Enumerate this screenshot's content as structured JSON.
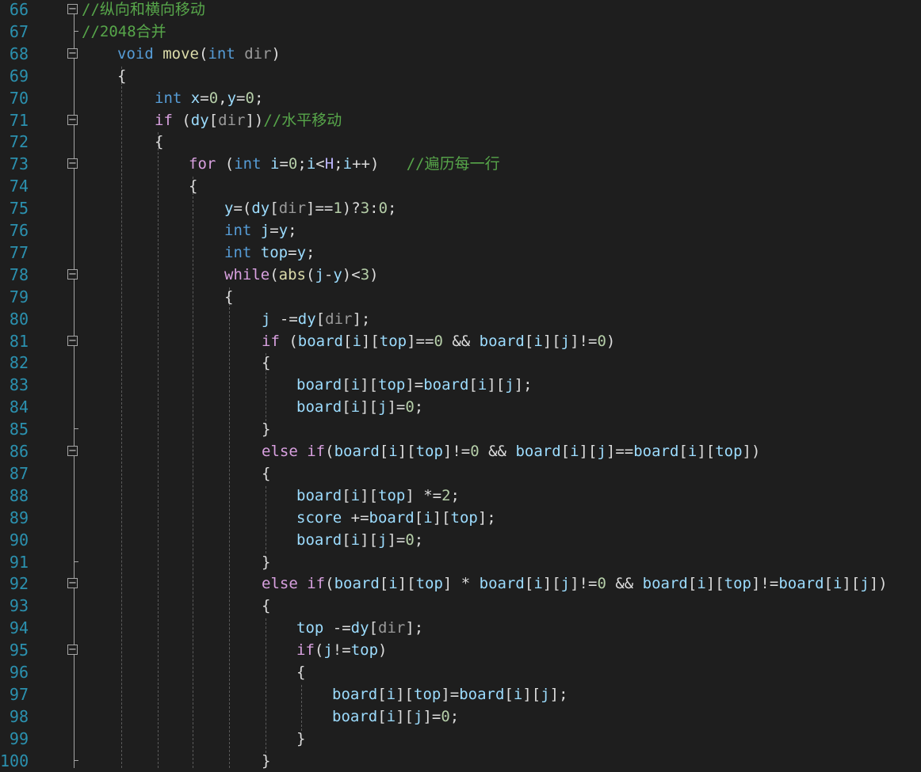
{
  "editor": {
    "theme_colors": {
      "background": "#1e1e1e",
      "line_number": "#2b91af",
      "keyword": "#569cd6",
      "control": "#d8a0df",
      "function": "#dcdcaa",
      "variable": "#9cdcfe",
      "parameter": "#9a9a9a",
      "number": "#b5cea8",
      "comment": "#57a64a",
      "plain": "#dcdcdc"
    },
    "fold_collapse_glyph": "−",
    "lines": [
      {
        "n": "66",
        "fold": "box",
        "indent": 0,
        "tokens": [
          [
            "cmt",
            "//纵向和横向移动"
          ]
        ]
      },
      {
        "n": "67",
        "fold": "end",
        "indent": 0,
        "tokens": [
          [
            "cmt",
            "//2048合并"
          ]
        ]
      },
      {
        "n": "68",
        "fold": "box",
        "indent": 1,
        "tokens": [
          [
            "kw",
            "void"
          ],
          [
            "op",
            " "
          ],
          [
            "fn",
            "move"
          ],
          [
            "op",
            "("
          ],
          [
            "kw",
            "int"
          ],
          [
            "op",
            " "
          ],
          [
            "param",
            "dir"
          ],
          [
            "op",
            ")"
          ]
        ]
      },
      {
        "n": "69",
        "fold": "",
        "indent": 1,
        "tokens": [
          [
            "op",
            "{"
          ]
        ]
      },
      {
        "n": "70",
        "fold": "",
        "indent": 2,
        "tokens": [
          [
            "kw",
            "int"
          ],
          [
            "op",
            " "
          ],
          [
            "var",
            "x"
          ],
          [
            "op",
            "="
          ],
          [
            "num",
            "0"
          ],
          [
            "op",
            ","
          ],
          [
            "var",
            "y"
          ],
          [
            "op",
            "="
          ],
          [
            "num",
            "0"
          ],
          [
            "op",
            ";"
          ]
        ]
      },
      {
        "n": "71",
        "fold": "box",
        "indent": 2,
        "tokens": [
          [
            "ctl",
            "if"
          ],
          [
            "op",
            " ("
          ],
          [
            "var",
            "dy"
          ],
          [
            "op",
            "["
          ],
          [
            "param",
            "dir"
          ],
          [
            "op",
            "])"
          ],
          [
            "cmt",
            "//水平移动"
          ]
        ]
      },
      {
        "n": "72",
        "fold": "",
        "indent": 2,
        "tokens": [
          [
            "op",
            "{"
          ]
        ]
      },
      {
        "n": "73",
        "fold": "box",
        "indent": 3,
        "tokens": [
          [
            "ctl",
            "for"
          ],
          [
            "op",
            " ("
          ],
          [
            "kw",
            "int"
          ],
          [
            "op",
            " "
          ],
          [
            "var",
            "i"
          ],
          [
            "op",
            "="
          ],
          [
            "num",
            "0"
          ],
          [
            "op",
            ";"
          ],
          [
            "var",
            "i"
          ],
          [
            "op",
            "<"
          ],
          [
            "mac",
            "H"
          ],
          [
            "op",
            ";"
          ],
          [
            "var",
            "i"
          ],
          [
            "op",
            "++)   "
          ],
          [
            "cmt",
            "//遍历每一行"
          ]
        ]
      },
      {
        "n": "74",
        "fold": "",
        "indent": 3,
        "tokens": [
          [
            "op",
            "{"
          ]
        ]
      },
      {
        "n": "75",
        "fold": "",
        "indent": 4,
        "tokens": [
          [
            "var",
            "y"
          ],
          [
            "op",
            "=("
          ],
          [
            "var",
            "dy"
          ],
          [
            "op",
            "["
          ],
          [
            "param",
            "dir"
          ],
          [
            "op",
            "]=="
          ],
          [
            "num",
            "1"
          ],
          [
            "op",
            ")?"
          ],
          [
            "num",
            "3"
          ],
          [
            "op",
            ":"
          ],
          [
            "num",
            "0"
          ],
          [
            "op",
            ";"
          ]
        ]
      },
      {
        "n": "76",
        "fold": "",
        "indent": 4,
        "tokens": [
          [
            "kw",
            "int"
          ],
          [
            "op",
            " "
          ],
          [
            "var",
            "j"
          ],
          [
            "op",
            "="
          ],
          [
            "var",
            "y"
          ],
          [
            "op",
            ";"
          ]
        ]
      },
      {
        "n": "77",
        "fold": "",
        "indent": 4,
        "tokens": [
          [
            "kw",
            "int"
          ],
          [
            "op",
            " "
          ],
          [
            "var",
            "top"
          ],
          [
            "op",
            "="
          ],
          [
            "var",
            "y"
          ],
          [
            "op",
            ";"
          ]
        ]
      },
      {
        "n": "78",
        "fold": "box",
        "indent": 4,
        "tokens": [
          [
            "ctl",
            "while"
          ],
          [
            "op",
            "("
          ],
          [
            "fn",
            "abs"
          ],
          [
            "op",
            "("
          ],
          [
            "var",
            "j"
          ],
          [
            "op",
            "-"
          ],
          [
            "var",
            "y"
          ],
          [
            "op",
            ")<"
          ],
          [
            "num",
            "3"
          ],
          [
            "op",
            ")"
          ]
        ]
      },
      {
        "n": "79",
        "fold": "",
        "indent": 4,
        "tokens": [
          [
            "op",
            "{"
          ]
        ]
      },
      {
        "n": "80",
        "fold": "",
        "indent": 5,
        "tokens": [
          [
            "var",
            "j"
          ],
          [
            "op",
            " -="
          ],
          [
            "var",
            "dy"
          ],
          [
            "op",
            "["
          ],
          [
            "param",
            "dir"
          ],
          [
            "op",
            "];"
          ]
        ]
      },
      {
        "n": "81",
        "fold": "box",
        "indent": 5,
        "tokens": [
          [
            "ctl",
            "if"
          ],
          [
            "op",
            " ("
          ],
          [
            "var",
            "board"
          ],
          [
            "op",
            "["
          ],
          [
            "var",
            "i"
          ],
          [
            "op",
            "]["
          ],
          [
            "var",
            "top"
          ],
          [
            "op",
            "]=="
          ],
          [
            "num",
            "0"
          ],
          [
            "op",
            " && "
          ],
          [
            "var",
            "board"
          ],
          [
            "op",
            "["
          ],
          [
            "var",
            "i"
          ],
          [
            "op",
            "]["
          ],
          [
            "var",
            "j"
          ],
          [
            "op",
            "]!="
          ],
          [
            "num",
            "0"
          ],
          [
            "op",
            ")"
          ]
        ]
      },
      {
        "n": "82",
        "fold": "",
        "indent": 5,
        "tokens": [
          [
            "op",
            "{"
          ]
        ]
      },
      {
        "n": "83",
        "fold": "",
        "indent": 6,
        "tokens": [
          [
            "var",
            "board"
          ],
          [
            "op",
            "["
          ],
          [
            "var",
            "i"
          ],
          [
            "op",
            "]["
          ],
          [
            "var",
            "top"
          ],
          [
            "op",
            "]="
          ],
          [
            "var",
            "board"
          ],
          [
            "op",
            "["
          ],
          [
            "var",
            "i"
          ],
          [
            "op",
            "]["
          ],
          [
            "var",
            "j"
          ],
          [
            "op",
            "];"
          ]
        ]
      },
      {
        "n": "84",
        "fold": "",
        "indent": 6,
        "tokens": [
          [
            "var",
            "board"
          ],
          [
            "op",
            "["
          ],
          [
            "var",
            "i"
          ],
          [
            "op",
            "]["
          ],
          [
            "var",
            "j"
          ],
          [
            "op",
            "]="
          ],
          [
            "num",
            "0"
          ],
          [
            "op",
            ";"
          ]
        ]
      },
      {
        "n": "85",
        "fold": "end",
        "indent": 5,
        "tokens": [
          [
            "op",
            "}"
          ]
        ]
      },
      {
        "n": "86",
        "fold": "box",
        "indent": 5,
        "tokens": [
          [
            "ctl",
            "else"
          ],
          [
            "op",
            " "
          ],
          [
            "ctl",
            "if"
          ],
          [
            "op",
            "("
          ],
          [
            "var",
            "board"
          ],
          [
            "op",
            "["
          ],
          [
            "var",
            "i"
          ],
          [
            "op",
            "]["
          ],
          [
            "var",
            "top"
          ],
          [
            "op",
            "]!="
          ],
          [
            "num",
            "0"
          ],
          [
            "op",
            " && "
          ],
          [
            "var",
            "board"
          ],
          [
            "op",
            "["
          ],
          [
            "var",
            "i"
          ],
          [
            "op",
            "]["
          ],
          [
            "var",
            "j"
          ],
          [
            "op",
            "]=="
          ],
          [
            "var",
            "board"
          ],
          [
            "op",
            "["
          ],
          [
            "var",
            "i"
          ],
          [
            "op",
            "]["
          ],
          [
            "var",
            "top"
          ],
          [
            "op",
            "])"
          ]
        ]
      },
      {
        "n": "87",
        "fold": "",
        "indent": 5,
        "tokens": [
          [
            "op",
            "{"
          ]
        ]
      },
      {
        "n": "88",
        "fold": "",
        "indent": 6,
        "tokens": [
          [
            "var",
            "board"
          ],
          [
            "op",
            "["
          ],
          [
            "var",
            "i"
          ],
          [
            "op",
            "]["
          ],
          [
            "var",
            "top"
          ],
          [
            "op",
            "] *="
          ],
          [
            "num",
            "2"
          ],
          [
            "op",
            ";"
          ]
        ]
      },
      {
        "n": "89",
        "fold": "",
        "indent": 6,
        "tokens": [
          [
            "var",
            "score"
          ],
          [
            "op",
            " +="
          ],
          [
            "var",
            "board"
          ],
          [
            "op",
            "["
          ],
          [
            "var",
            "i"
          ],
          [
            "op",
            "]["
          ],
          [
            "var",
            "top"
          ],
          [
            "op",
            "];"
          ]
        ]
      },
      {
        "n": "90",
        "fold": "",
        "indent": 6,
        "tokens": [
          [
            "var",
            "board"
          ],
          [
            "op",
            "["
          ],
          [
            "var",
            "i"
          ],
          [
            "op",
            "]["
          ],
          [
            "var",
            "j"
          ],
          [
            "op",
            "]="
          ],
          [
            "num",
            "0"
          ],
          [
            "op",
            ";"
          ]
        ]
      },
      {
        "n": "91",
        "fold": "end",
        "indent": 5,
        "tokens": [
          [
            "op",
            "}"
          ]
        ]
      },
      {
        "n": "92",
        "fold": "box",
        "indent": 5,
        "tokens": [
          [
            "ctl",
            "else"
          ],
          [
            "op",
            " "
          ],
          [
            "ctl",
            "if"
          ],
          [
            "op",
            "("
          ],
          [
            "var",
            "board"
          ],
          [
            "op",
            "["
          ],
          [
            "var",
            "i"
          ],
          [
            "op",
            "]["
          ],
          [
            "var",
            "top"
          ],
          [
            "op",
            "] * "
          ],
          [
            "var",
            "board"
          ],
          [
            "op",
            "["
          ],
          [
            "var",
            "i"
          ],
          [
            "op",
            "]["
          ],
          [
            "var",
            "j"
          ],
          [
            "op",
            "]!="
          ],
          [
            "num",
            "0"
          ],
          [
            "op",
            " && "
          ],
          [
            "var",
            "board"
          ],
          [
            "op",
            "["
          ],
          [
            "var",
            "i"
          ],
          [
            "op",
            "]["
          ],
          [
            "var",
            "top"
          ],
          [
            "op",
            "]!="
          ],
          [
            "var",
            "board"
          ],
          [
            "op",
            "["
          ],
          [
            "var",
            "i"
          ],
          [
            "op",
            "]["
          ],
          [
            "var",
            "j"
          ],
          [
            "op",
            "])"
          ]
        ]
      },
      {
        "n": "93",
        "fold": "",
        "indent": 5,
        "tokens": [
          [
            "op",
            "{"
          ]
        ]
      },
      {
        "n": "94",
        "fold": "",
        "indent": 6,
        "tokens": [
          [
            "var",
            "top"
          ],
          [
            "op",
            " -="
          ],
          [
            "var",
            "dy"
          ],
          [
            "op",
            "["
          ],
          [
            "param",
            "dir"
          ],
          [
            "op",
            "];"
          ]
        ]
      },
      {
        "n": "95",
        "fold": "box",
        "indent": 6,
        "tokens": [
          [
            "ctl",
            "if"
          ],
          [
            "op",
            "("
          ],
          [
            "var",
            "j"
          ],
          [
            "op",
            "!="
          ],
          [
            "var",
            "top"
          ],
          [
            "op",
            ")"
          ]
        ]
      },
      {
        "n": "96",
        "fold": "",
        "indent": 6,
        "tokens": [
          [
            "op",
            "{"
          ]
        ]
      },
      {
        "n": "97",
        "fold": "",
        "indent": 7,
        "tokens": [
          [
            "var",
            "board"
          ],
          [
            "op",
            "["
          ],
          [
            "var",
            "i"
          ],
          [
            "op",
            "]["
          ],
          [
            "var",
            "top"
          ],
          [
            "op",
            "]="
          ],
          [
            "var",
            "board"
          ],
          [
            "op",
            "["
          ],
          [
            "var",
            "i"
          ],
          [
            "op",
            "]["
          ],
          [
            "var",
            "j"
          ],
          [
            "op",
            "];"
          ]
        ]
      },
      {
        "n": "98",
        "fold": "",
        "indent": 7,
        "tokens": [
          [
            "var",
            "board"
          ],
          [
            "op",
            "["
          ],
          [
            "var",
            "i"
          ],
          [
            "op",
            "]["
          ],
          [
            "var",
            "j"
          ],
          [
            "op",
            "]="
          ],
          [
            "num",
            "0"
          ],
          [
            "op",
            ";"
          ]
        ]
      },
      {
        "n": "99",
        "fold": "",
        "indent": 6,
        "tokens": [
          [
            "op",
            "}"
          ]
        ]
      },
      {
        "n": "100",
        "fold": "end",
        "indent": 5,
        "tokens": [
          [
            "op",
            "}"
          ]
        ]
      }
    ]
  }
}
